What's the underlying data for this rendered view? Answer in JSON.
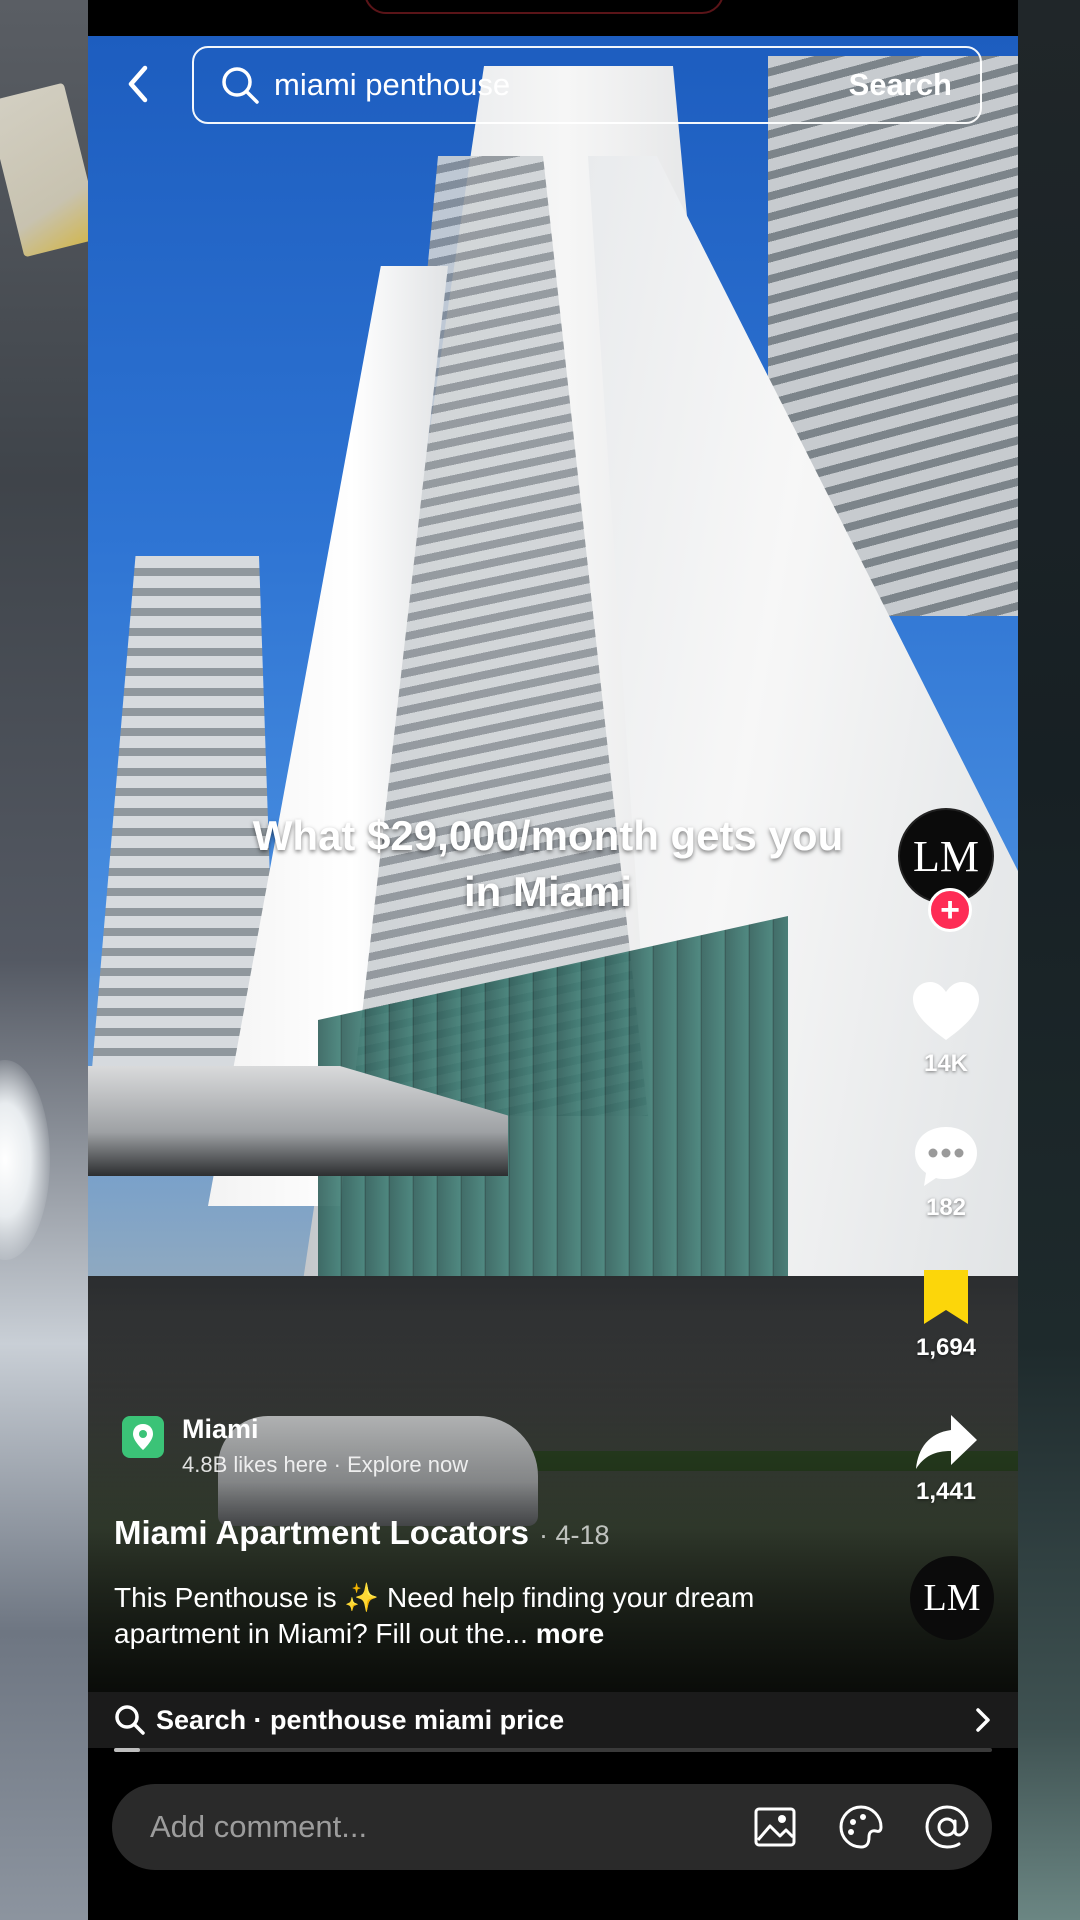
{
  "search": {
    "query": "miami penthouse",
    "button_label": "Search"
  },
  "video": {
    "overlay_caption": "What $29,000/month gets you in Miami"
  },
  "creator": {
    "avatar_initials": "LM"
  },
  "actions": {
    "likes": "14K",
    "comments": "182",
    "saves": "1,694",
    "shares": "1,441"
  },
  "location": {
    "name": "Miami",
    "subtitle": "4.8B likes here · Explore now"
  },
  "post": {
    "author": "Miami Apartment Locators",
    "date": "· 4-18",
    "description": "This Penthouse is ✨ Need help finding your dream apartment in Miami? Fill out the...",
    "more_label": "more"
  },
  "related_search": {
    "text": "Search · penthouse miami price"
  },
  "playback": {
    "progress_fraction": 0.03
  },
  "comment_bar": {
    "placeholder": "Add comment..."
  },
  "colors": {
    "follow_plus": "#fe2c55",
    "save_icon": "#fcd60a",
    "location_icon": "#3bc377"
  },
  "icons": [
    "back-icon",
    "search-icon",
    "heart-icon",
    "comment-icon",
    "bookmark-icon",
    "share-icon",
    "pin-icon",
    "chevron-right-icon",
    "image-icon",
    "emoji-icon",
    "mention-icon"
  ]
}
